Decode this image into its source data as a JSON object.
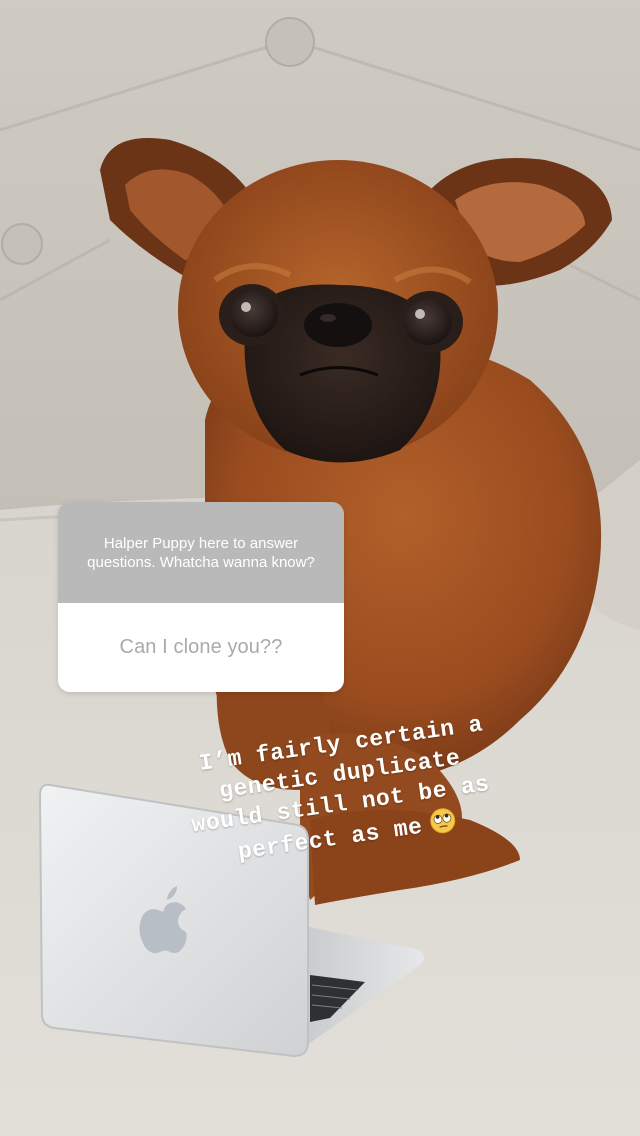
{
  "question_sticker": {
    "prompt": "Halper Puppy here to answer questions. Whatcha wanna know?",
    "answer": "Can I clone you??"
  },
  "caption": {
    "line1": "I’m fairly certain a",
    "line2": "genetic duplicate",
    "line3": "would still not be as",
    "line4": "perfect as me",
    "emoji": "face-with-rolling-eyes"
  },
  "colors": {
    "sticker_header": "#b9b9b9",
    "sticker_body": "#ffffff",
    "answer_text": "#a9a9a9",
    "caption_text": "#ffffff"
  }
}
